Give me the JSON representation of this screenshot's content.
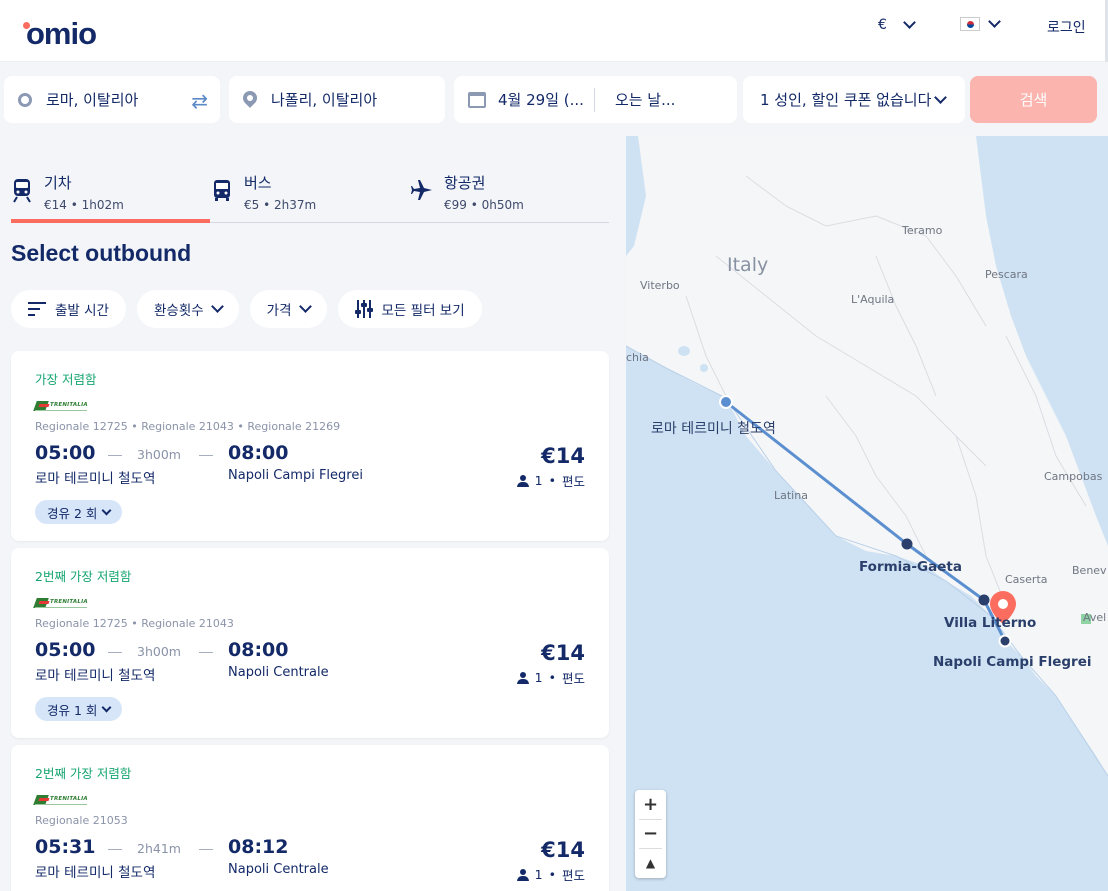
{
  "header": {
    "logo": "omio",
    "currency": "€",
    "login": "로그인"
  },
  "search": {
    "origin": "로마, 이탈리아",
    "destination": "나폴리, 이탈리아",
    "depart_date": "4월 29일 (...",
    "return_date": "오는 날...",
    "passengers": "1 성인, 할인 쿠폰 없습니다",
    "button": "검색"
  },
  "tabs": [
    {
      "label": "기차",
      "sub": "€14 • 1h02m",
      "active": true
    },
    {
      "label": "버스",
      "sub": "€5 • 2h37m"
    },
    {
      "label": "항공권",
      "sub": "€99 • 0h50m"
    }
  ],
  "section_title": "Select outbound",
  "filters": {
    "depart_time": "출발 시간",
    "transfers": "환승횟수",
    "price": "가격",
    "all_filters": "모든 필터 보기"
  },
  "results": [
    {
      "badge": "가장 저렴함",
      "carrier": "TRENITALIA",
      "services": "Regionale 12725 • Regionale 21043 • Regionale 21269",
      "dep_time": "05:00",
      "duration": "3h00m",
      "arr_time": "08:00",
      "dep_station": "로마 테르미니 철도역",
      "arr_station": "Napoli Campi Flegrei",
      "price": "€14",
      "pax": "1",
      "trip": "편도",
      "stops": "경유 2 회"
    },
    {
      "badge": "2번째 가장 저렴함",
      "carrier": "TRENITALIA",
      "services": "Regionale 12725 • Regionale 21043",
      "dep_time": "05:00",
      "duration": "3h00m",
      "arr_time": "08:00",
      "dep_station": "로마 테르미니 철도역",
      "arr_station": "Napoli Centrale",
      "price": "€14",
      "pax": "1",
      "trip": "편도",
      "stops": "경유 1 회"
    },
    {
      "badge": "2번째 가장 저렴함",
      "carrier": "TRENITALIA",
      "services": "Regionale 21053",
      "dep_time": "05:31",
      "duration": "2h41m",
      "arr_time": "08:12",
      "dep_station": "로마 테르미니 철도역",
      "arr_station": "Napoli Centrale",
      "price": "€14",
      "pax": "1",
      "trip": "편도",
      "stops": ""
    }
  ],
  "map": {
    "labels": {
      "italy": "Italy",
      "teramo": "Teramo",
      "viterbo": "Viterbo",
      "pescara": "Pescara",
      "laquila": "L'Aquila",
      "chia": "chia",
      "rome": "로마 테르미니 철도역",
      "latina": "Latina",
      "campobasso": "Campobas",
      "formia": "Formia-Gaeta",
      "caserta": "Caserta",
      "benev": "Benev",
      "villa": "Villa Literno",
      "avel": "Avel",
      "napoli": "Napoli Campi Flegrei"
    },
    "zoom_in": "+",
    "zoom_out": "−",
    "compass": "▲"
  },
  "colors": {
    "brand": "#132968",
    "accent": "#fc6c5f",
    "route": "#5b8fd0",
    "cheap": "#17a672"
  }
}
